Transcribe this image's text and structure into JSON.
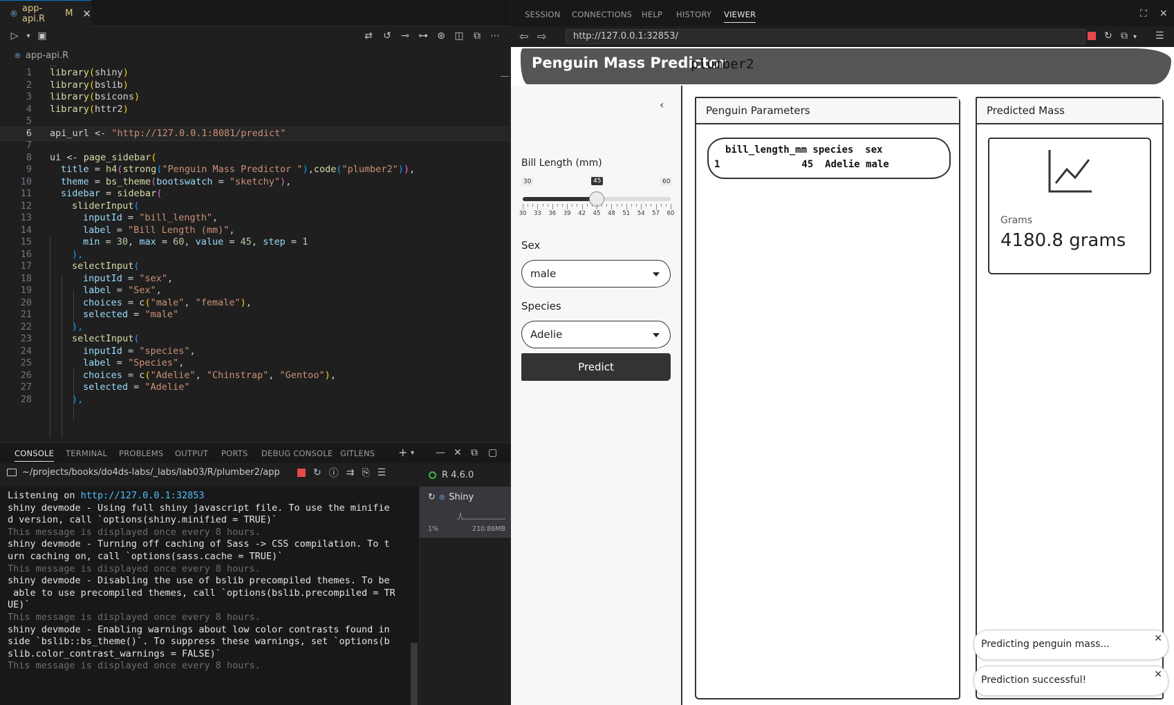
{
  "editor": {
    "tab_label": "app-api.R",
    "tab_status": "M",
    "tab_close": "✕",
    "breadcrumb": "app-api.R",
    "fold_hint": "...",
    "lines": [
      {
        "n": "1"
      },
      {
        "n": "2"
      },
      {
        "n": "3"
      },
      {
        "n": "4"
      },
      {
        "n": "5"
      },
      {
        "n": "6"
      },
      {
        "n": "7"
      },
      {
        "n": "8"
      },
      {
        "n": "9"
      },
      {
        "n": "10"
      },
      {
        "n": "11"
      },
      {
        "n": "12"
      },
      {
        "n": "13"
      },
      {
        "n": "14"
      },
      {
        "n": "15"
      },
      {
        "n": "16"
      },
      {
        "n": "17"
      },
      {
        "n": "18"
      },
      {
        "n": "19"
      },
      {
        "n": "20"
      },
      {
        "n": "21"
      },
      {
        "n": "22"
      },
      {
        "n": "23"
      },
      {
        "n": "24"
      },
      {
        "n": "25"
      },
      {
        "n": "26"
      },
      {
        "n": "27"
      },
      {
        "n": "28"
      }
    ],
    "code": {
      "l1": [
        "library",
        "(",
        "shiny",
        ")"
      ],
      "l2": [
        "library",
        "(",
        "bslib",
        ")"
      ],
      "l3": [
        "library",
        "(",
        "bsicons",
        ")"
      ],
      "l4": [
        "library",
        "(",
        "httr2",
        ")"
      ],
      "l6": [
        "api_url",
        " <- ",
        "\"http://127.0.0.1:8081/predict\""
      ],
      "l8": [
        "ui",
        " <- ",
        "page_sidebar",
        "("
      ],
      "l9": [
        "title",
        " = ",
        "h4",
        "(",
        "strong",
        "(",
        "\"Penguin Mass Predictor \"",
        ")",
        ",",
        "code",
        "(",
        "\"plumber2\"",
        ")",
        ")",
        ","
      ],
      "l10": [
        "theme",
        " = ",
        "bs_theme",
        "(",
        "bootswatch",
        " = ",
        "\"sketchy\"",
        ")",
        ","
      ],
      "l11": [
        "sidebar",
        " = ",
        "sidebar",
        "("
      ],
      "l12": [
        "sliderInput",
        "("
      ],
      "l13": [
        "inputId",
        " = ",
        "\"bill_length\"",
        ","
      ],
      "l14": [
        "label",
        " = ",
        "\"Bill Length (mm)\"",
        ","
      ],
      "l15": [
        "min",
        " = ",
        "30",
        ", ",
        "max",
        " = ",
        "60",
        ", ",
        "value",
        " = ",
        "45",
        ", ",
        "step",
        " = ",
        "1"
      ],
      "l16": [
        "),"
      ],
      "l17": [
        "selectInput",
        "("
      ],
      "l18": [
        "inputId",
        " = ",
        "\"sex\"",
        ","
      ],
      "l19": [
        "label",
        " = ",
        "\"Sex\"",
        ","
      ],
      "l20": [
        "choices",
        " = ",
        "c",
        "(",
        "\"male\"",
        ", ",
        "\"female\"",
        ")",
        ","
      ],
      "l21": [
        "selected",
        " = ",
        "\"male\""
      ],
      "l22": [
        "),"
      ],
      "l23": [
        "selectInput",
        "("
      ],
      "l24": [
        "inputId",
        " = ",
        "\"species\"",
        ","
      ],
      "l25": [
        "label",
        " = ",
        "\"Species\"",
        ","
      ],
      "l26": [
        "choices",
        " = ",
        "c",
        "(",
        "\"Adelie\"",
        ", ",
        "\"Chinstrap\"",
        ", ",
        "\"Gentoo\"",
        ")",
        ","
      ],
      "l27": [
        "selected",
        " = ",
        "\"Adelie\""
      ],
      "l28": [
        "),"
      ]
    }
  },
  "panel": {
    "tabs": [
      "CONSOLE",
      "TERMINAL",
      "PROBLEMS",
      "OUTPUT",
      "PORTS",
      "DEBUG CONSOLE",
      "GITLENS"
    ],
    "add": "+",
    "path": "~/projects/books/do4ds-labs/_labs/lab03/R/plumber2/app",
    "r_version": "R 4.6.0",
    "session_name": "Shiny",
    "cpu": "1%",
    "mem": "210.86MB",
    "console_lines": [
      {
        "text": "Listening on ",
        "link": "http://127.0.0.1:32853",
        "dim": false
      },
      {
        "text": "shiny devmode - Using full shiny javascript file. To use the minifie",
        "dim": false
      },
      {
        "text": "d version, call `options(shiny.minified = TRUE)`",
        "dim": false
      },
      {
        "text": "This message is displayed once every 8 hours.",
        "dim": true
      },
      {
        "text": "shiny devmode - Turning off caching of Sass -> CSS compilation. To t",
        "dim": false
      },
      {
        "text": "urn caching on, call `options(sass.cache = TRUE)`",
        "dim": false
      },
      {
        "text": "This message is displayed once every 8 hours.",
        "dim": true
      },
      {
        "text": "shiny devmode - Disabling the use of bslib precompiled themes. To be",
        "dim": false
      },
      {
        "text": " able to use precompiled themes, call `options(bslib.precompiled = TR",
        "dim": false
      },
      {
        "text": "UE)`",
        "dim": false
      },
      {
        "text": "This message is displayed once every 8 hours.",
        "dim": true
      },
      {
        "text": "shiny devmode - Enabling warnings about low color contrasts found in",
        "dim": false
      },
      {
        "text": "side `bslib::bs_theme()`. To suppress these warnings, set `options(b",
        "dim": false
      },
      {
        "text": "slib.color_contrast_warnings = FALSE)`",
        "dim": false
      },
      {
        "text": "This message is displayed once every 8 hours.",
        "dim": true
      }
    ]
  },
  "viewer": {
    "tabs": [
      "SESSION",
      "CONNECTIONS",
      "HELP",
      "HISTORY",
      "VIEWER"
    ],
    "active_tab": "VIEWER",
    "url": "http://127.0.0.1:32853/"
  },
  "app": {
    "title": "Penguin Mass Predictor",
    "code_tag": "plumber2",
    "slider": {
      "label": "Bill Length (mm)",
      "min": 30,
      "max": 60,
      "value": 45,
      "min_label": "30",
      "max_label": "60",
      "value_label": "45",
      "tick_labels": [
        "30",
        "33",
        "36",
        "39",
        "42",
        "45",
        "48",
        "51",
        "54",
        "57",
        "60"
      ]
    },
    "sex": {
      "label": "Sex",
      "selected": "male"
    },
    "species": {
      "label": "Species",
      "selected": "Adelie"
    },
    "predict_label": "Predict",
    "params_card": {
      "header": "Penguin Parameters",
      "table_header": "bill_length_mm species  sex",
      "table_row": "1              45  Adelie male"
    },
    "mass_card": {
      "header": "Predicted Mass",
      "label": "Grams",
      "value": "4180.8 grams"
    },
    "toasts": [
      "Predicting penguin mass...",
      "Prediction successful!"
    ]
  }
}
